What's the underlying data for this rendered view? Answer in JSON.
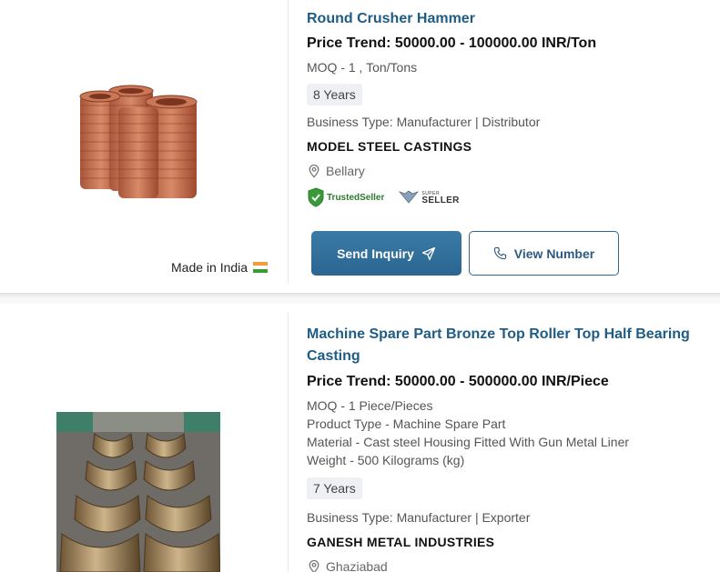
{
  "listings": [
    {
      "title": "Round Crusher Hammer",
      "price": "Price Trend: 50000.00 - 100000.00 INR/Ton",
      "details": [
        "MOQ - 1 , Ton/Tons"
      ],
      "years": "8 Years",
      "business_type": "Business Type: Manufacturer | Distributor",
      "company": "MODEL STEEL CASTINGS",
      "location": "Bellary",
      "badges": {
        "trusted": "TrustedSeller",
        "super_top": "SUPER",
        "super_main": "SELLER"
      },
      "buttons": {
        "inquiry": "Send Inquiry",
        "view": "View Number"
      },
      "made_in": "Made in India"
    },
    {
      "title": "Machine Spare Part Bronze Top Roller Top Half Bearing Casting",
      "price": "Price Trend: 50000.00 - 500000.00 INR/Piece",
      "details": [
        "MOQ - 1 Piece/Pieces",
        "Product Type - Machine Spare Part",
        "Material - Cast steel Housing Fitted With Gun Metal Liner",
        "Weight - 500 Kilograms (kg)"
      ],
      "years": "7 Years",
      "business_type": "Business Type: Manufacturer | Exporter",
      "company": "GANESH METAL INDUSTRIES",
      "location": "Ghaziabad"
    }
  ],
  "colors": {
    "accent": "#1f5c85",
    "button": "#2c6692",
    "trusted_green": "#2d7a30"
  },
  "icons": [
    "map-pin-icon",
    "send-icon",
    "phone-icon",
    "trusted-seller-icon",
    "super-seller-icon",
    "india-flag-icon"
  ]
}
